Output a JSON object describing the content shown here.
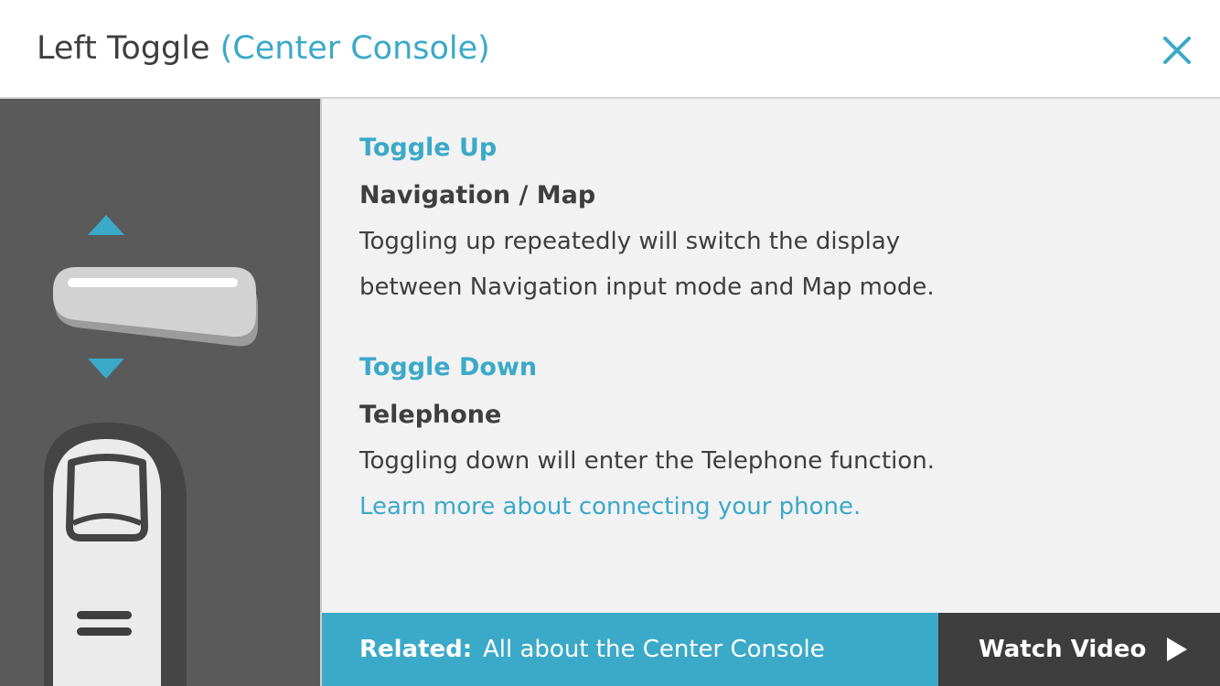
{
  "header": {
    "title": "Left Toggle",
    "subtitle": "(Center Console)",
    "close_icon": "close-icon"
  },
  "sidebar": {
    "illustration": "toggle-switch-with-finger",
    "up_icon": "arrow-up-icon",
    "down_icon": "arrow-down-icon"
  },
  "content": {
    "toggle_up": {
      "heading": "Toggle Up",
      "title": "Navigation / Map",
      "line1": "Toggling up repeatedly will switch the display",
      "line2": "between Navigation input mode and Map mode."
    },
    "toggle_down": {
      "heading": "Toggle Down",
      "title": "Telephone",
      "description": "Toggling down will enter the Telephone function.",
      "link": "Learn more about connecting your phone."
    }
  },
  "footer": {
    "related_label": "Related:",
    "related_text": "All about the Center Console",
    "watch_label": "Watch Video",
    "play_icon": "play-icon"
  },
  "colors": {
    "accent": "#3ba9c8",
    "dark": "#3e3e3e",
    "sidebar": "#5a5a5a",
    "panel": "#f2f2f2"
  }
}
